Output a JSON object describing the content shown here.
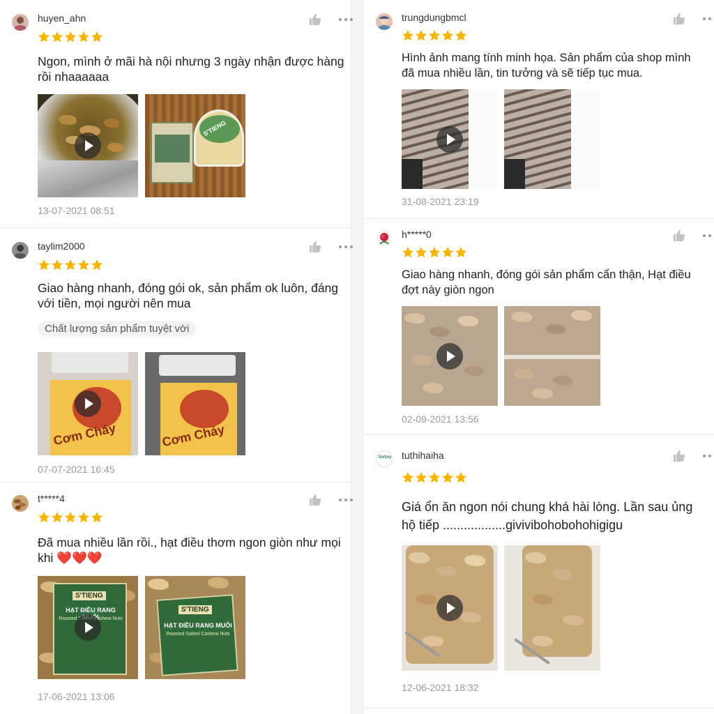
{
  "colors": {
    "star": "#f8b400",
    "icon": "#c2c2c2",
    "timestamp": "#9a9a9a"
  },
  "icons": {
    "like": "thumbs-up-icon",
    "more": "more-horizontal-icon",
    "star": "star-icon",
    "play": "play-icon"
  },
  "left_reviews": [
    {
      "username": "huyen_ahn",
      "rating": 5,
      "text": "Ngon, mình ở mãi hà nội nhưng 3 ngày nhận được hàng rồi nhaaaaaa",
      "timestamp": "13-07-2021 08:51"
    },
    {
      "username": "taylim2000",
      "rating": 5,
      "text": "Giao hàng nhanh, đóng gói ok, sản phẩm ok luôn, đáng với tiền, mọi người nên mua",
      "tag": "Chất lượng sản phẩm tuyệt vời",
      "timestamp": "07-07-2021 16:45"
    },
    {
      "username": "t*****4",
      "rating": 5,
      "text": "Đã mua nhiều lần rồi., hạt điều thơm ngon giòn như mọi khi ❤️❤️❤️",
      "timestamp": "17-06-2021 13:06"
    }
  ],
  "right_reviews": [
    {
      "username": "trungdungbmcl",
      "rating": 5,
      "text": "Hình ảnh mang tính minh họa. Sản phẩm của shop mình đã mua nhiều lần, tin tưởng và sẽ tiếp tục mua.",
      "timestamp": "31-08-2021 23:19"
    },
    {
      "username": "h*****0",
      "rating": 5,
      "text": "Giao hàng nhanh, đóng gói sản phẩm cẩn thận, Hạt điều đợt này giòn ngon",
      "timestamp": "02-09-2021 13:56"
    },
    {
      "username": "tuthihaiha",
      "rating": 5,
      "text": "Giá ổn ăn ngon nói chung khá hài lòng. Lần sau ủng hộ tiếp ..................givivibohobohohigigu",
      "timestamp": "12-06-2021 18:32"
    }
  ],
  "image_labels": {
    "stieng": "S'TIENG",
    "com_chay": "Cơm Cháy",
    "hat_dieu": "HẠT ĐIỀU RANG MUỐI",
    "roasted": "Roasted Salted Cashew Nuts",
    "avatar_logo": "SwSey"
  }
}
